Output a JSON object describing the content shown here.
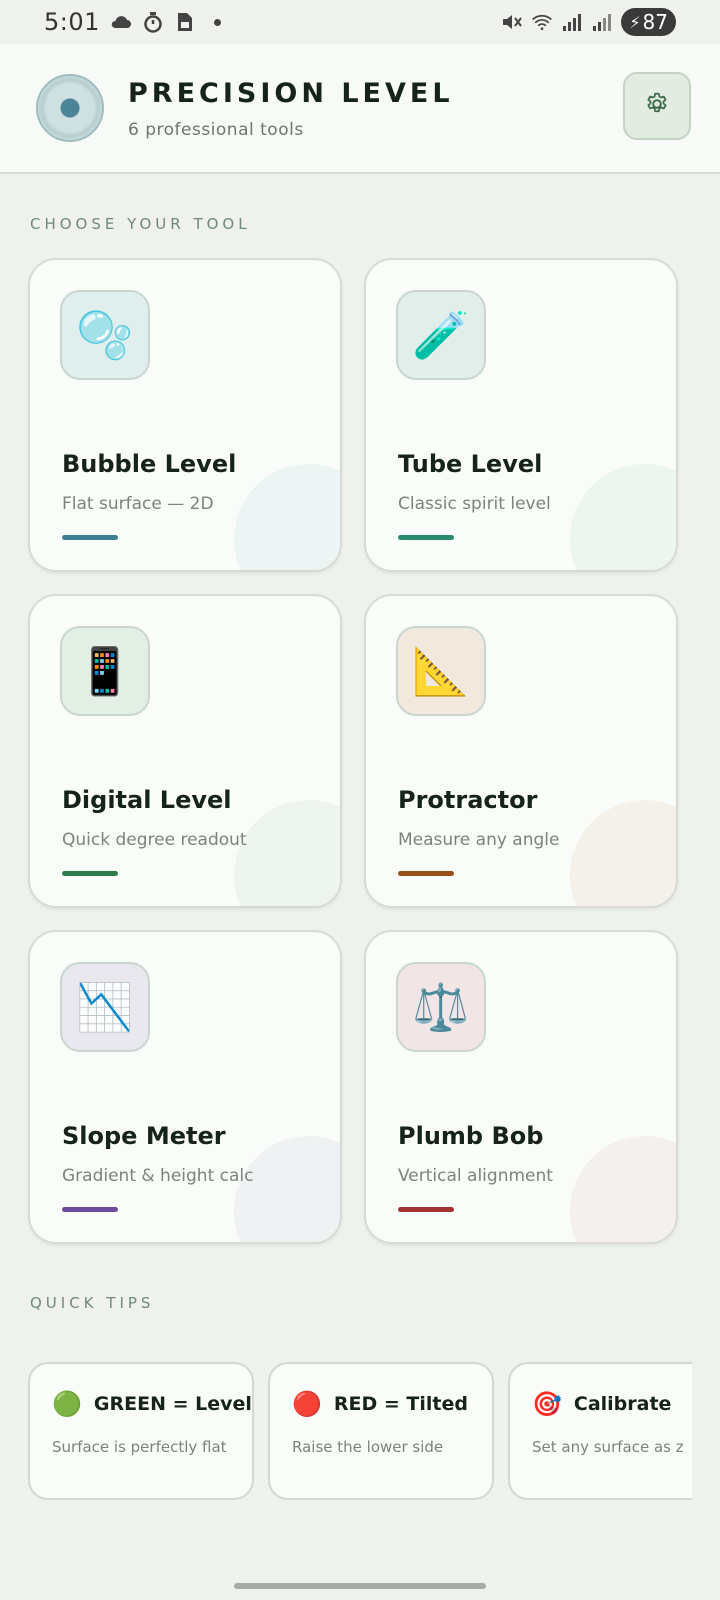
{
  "status_bar": {
    "time": "5:01",
    "battery": "87"
  },
  "header": {
    "title": "PRECISION LEVEL",
    "subtitle": "6 professional tools"
  },
  "sections": {
    "tools_label": "CHOOSE YOUR TOOL",
    "tips_label": "QUICK TIPS"
  },
  "tools": [
    {
      "name": "Bubble Level",
      "desc": "Flat surface — 2D",
      "icon": "🫧",
      "icon_name": "bubbles-icon",
      "accent": "#3e7d93",
      "tile_bg": "#e1eeee"
    },
    {
      "name": "Tube Level",
      "desc": "Classic spirit level",
      "icon": "🧪",
      "icon_name": "test-tube-icon",
      "accent": "#2a8a6d",
      "tile_bg": "#e1eee9"
    },
    {
      "name": "Digital Level",
      "desc": "Quick degree readout",
      "icon": "📱",
      "icon_name": "mobile-phone-icon",
      "accent": "#2f7d4d",
      "tile_bg": "#e3eee5"
    },
    {
      "name": "Protractor",
      "desc": "Measure any angle",
      "icon": "📐",
      "icon_name": "triangular-ruler-icon",
      "accent": "#9b4f1a",
      "tile_bg": "#f1e8de"
    },
    {
      "name": "Slope Meter",
      "desc": "Gradient & height calc",
      "icon": "📉",
      "icon_name": "chart-decreasing-icon",
      "accent": "#6c4ba1",
      "tile_bg": "#e9e8ee"
    },
    {
      "name": "Plumb Bob",
      "desc": "Vertical alignment",
      "icon": "⚖️",
      "icon_name": "balance-scale-icon",
      "accent": "#a33232",
      "tile_bg": "#f1e5e5"
    }
  ],
  "tips": [
    {
      "icon": "🟢",
      "icon_name": "green-circle-icon",
      "title": "GREEN = Level",
      "text": "Surface is perfectly flat"
    },
    {
      "icon": "🔴",
      "icon_name": "red-circle-icon",
      "title": "RED = Tilted",
      "text": "Raise the lower side"
    },
    {
      "icon": "🎯",
      "icon_name": "target-icon",
      "title": "Calibrate",
      "text": "Set any surface as z"
    }
  ]
}
